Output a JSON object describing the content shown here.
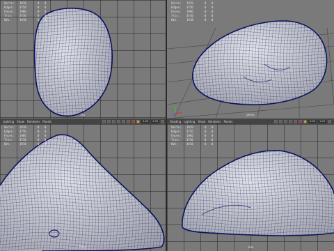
{
  "hud_labels": [
    "Verts:",
    "Edges:",
    "Faces:",
    "Tris:",
    "UVs:"
  ],
  "viewports": {
    "top_left": {
      "camera": "top",
      "stats": [
        {
          "a": "1978",
          "b": "0",
          "c": "0"
        },
        {
          "a": "3756",
          "b": "0",
          "c": "0"
        },
        {
          "a": "1966",
          "b": "0",
          "c": "0"
        },
        {
          "a": "3736",
          "b": "0",
          "c": "0"
        },
        {
          "a": "1918",
          "b": "0",
          "c": "0"
        }
      ]
    },
    "top_right": {
      "camera": "persp",
      "stats": [
        {
          "a": "1978",
          "b": "0",
          "c": "0"
        },
        {
          "a": "3756",
          "b": "0",
          "c": "0"
        },
        {
          "a": "1966",
          "b": "0",
          "c": "0"
        },
        {
          "a": "3736",
          "b": "0",
          "c": "0"
        },
        {
          "a": "1918",
          "b": "0",
          "c": "0"
        }
      ]
    },
    "bottom_left": {
      "camera": "front",
      "stats": [
        {
          "a": "1978",
          "b": "0",
          "c": "0"
        },
        {
          "a": "3756",
          "b": "0",
          "c": "0"
        },
        {
          "a": "1966",
          "b": "0",
          "c": "0"
        },
        {
          "a": "3736",
          "b": "0",
          "c": "0"
        },
        {
          "a": "1918",
          "b": "0",
          "c": "0"
        }
      ]
    },
    "bottom_right": {
      "camera": "side",
      "stats": [
        {
          "a": "1978",
          "b": "0",
          "c": "0"
        },
        {
          "a": "3756",
          "b": "0",
          "c": "0"
        },
        {
          "a": "1966",
          "b": "0",
          "c": "0"
        },
        {
          "a": "3736",
          "b": "0",
          "c": "0"
        },
        {
          "a": "1918",
          "b": "0",
          "c": "0"
        }
      ]
    }
  },
  "menus": {
    "left": [
      "Lighting",
      "Show",
      "Renderer",
      "Panels"
    ],
    "right": [
      "Shading",
      "Lighting",
      "Show",
      "Renderer",
      "Panels"
    ]
  },
  "toolbar": {
    "field_value_a": "0.00",
    "field_value_b": "1.00"
  },
  "colors": {
    "viewport_bg": "#7a7a7a",
    "mesh_fill": "#d0d0d6",
    "wire": "#1e2f66",
    "outline": "#0b1160"
  }
}
